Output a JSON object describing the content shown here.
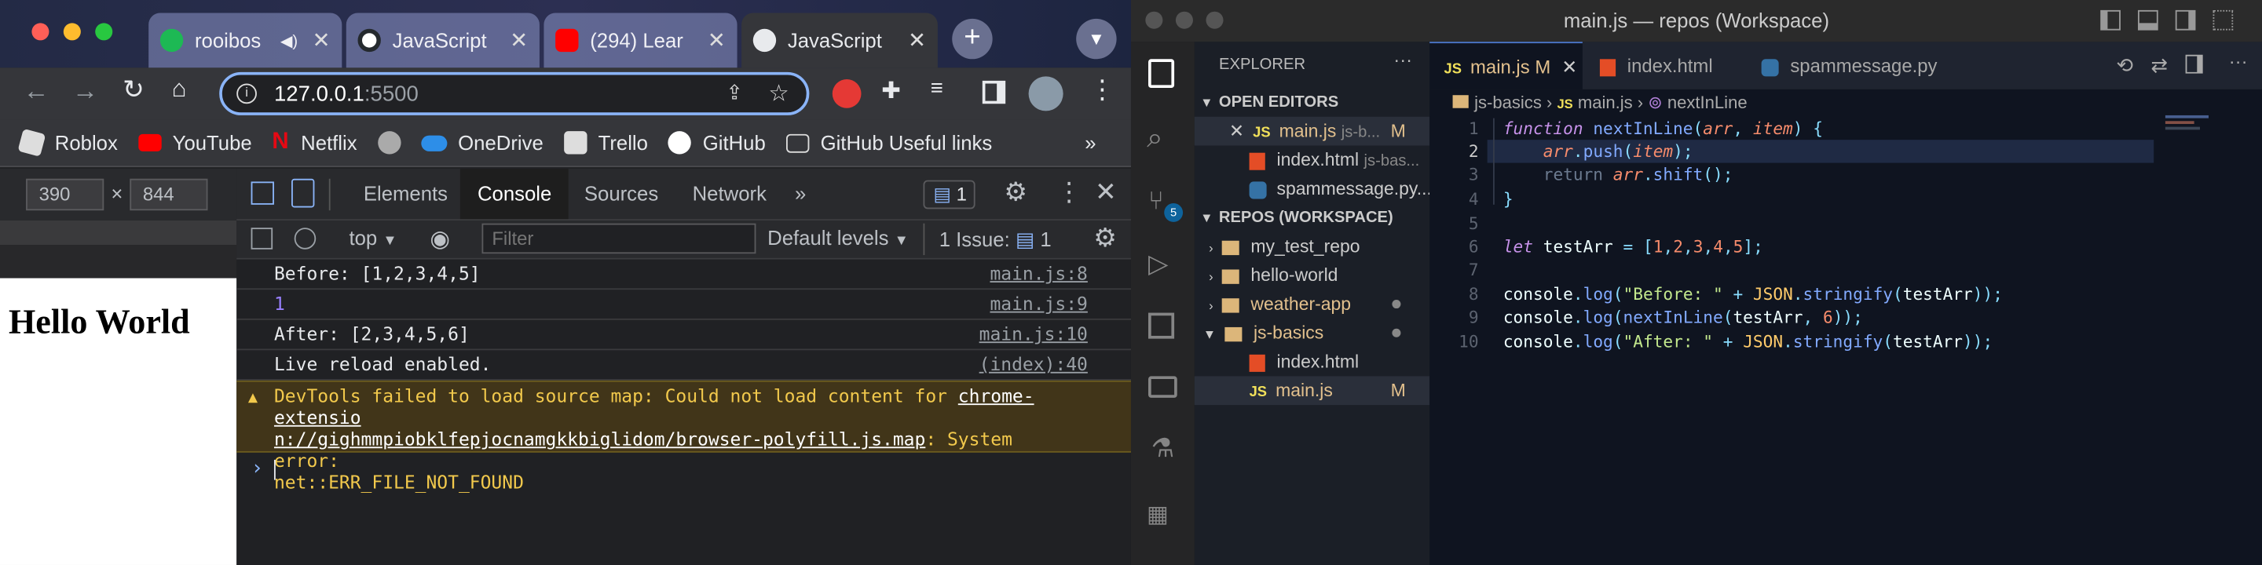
{
  "chrome": {
    "tabs": [
      {
        "label": "rooibos"
      },
      {
        "label": "JavaScript"
      },
      {
        "label": "(294) Lear"
      },
      {
        "label": "JavaScript"
      }
    ],
    "url_host": "127.0.0.1",
    "url_port": ":5500",
    "bookmarks": [
      "Roblox",
      "YouTube",
      "Netflix",
      "OneDrive",
      "Trello",
      "GitHub",
      "GitHub Useful links"
    ],
    "bookmarks_more": "»",
    "tab_close": "✕",
    "new_tab": "+",
    "more_tabs": "»"
  },
  "devtools": {
    "width": "390",
    "height": "844",
    "times": "×",
    "tabs": [
      "Elements",
      "Console",
      "Sources",
      "Network"
    ],
    "more": "»",
    "issues_badge": "1",
    "context": "top",
    "filter_placeholder": "Filter",
    "levels": "Default levels",
    "issues_text": "1 Issue:",
    "issues_count": "1",
    "page_heading": "Hello World",
    "console_rows": [
      {
        "text": "Before: [1,2,3,4,5]",
        "src": "main.js:8"
      },
      {
        "text": "1",
        "src": "main.js:9"
      },
      {
        "text": "After: [2,3,4,5,6]",
        "src": "main.js:10"
      },
      {
        "text": "Live reload enabled.",
        "src": "(index):40"
      }
    ],
    "warning_prefix": "DevTools failed to load source map: Could not load content for ",
    "warning_link_1": "chrome-extensio",
    "warning_link_2": "n://gighmmpiobklfepjocnamgkkbiglidom/browser-polyfill.js.map",
    "warning_suffix": ": System error:",
    "warning_error": "net::ERR_FILE_NOT_FOUND",
    "prompt": "›"
  },
  "vscode": {
    "title": "main.js — repos (Workspace)",
    "explorer": "EXPLORER",
    "open_editors": "OPEN EDITORS",
    "open_files": [
      {
        "name": "main.js",
        "path": "js-b...",
        "status": "M"
      },
      {
        "name": "index.html",
        "path": "js-bas..."
      },
      {
        "name": "spammessage.py..."
      }
    ],
    "workspace": "REPOS (WORKSPACE)",
    "folders": [
      {
        "name": "my_test_repo"
      },
      {
        "name": "hello-world"
      },
      {
        "name": "weather-app"
      },
      {
        "name": "js-basics"
      }
    ],
    "js_basics_files": [
      {
        "name": "index.html"
      },
      {
        "name": "main.js",
        "status": "M"
      }
    ],
    "scm_badge": "5",
    "editor_tabs": [
      {
        "name": "main.js",
        "status": "M"
      },
      {
        "name": "index.html"
      },
      {
        "name": "spammessage.py"
      }
    ],
    "breadcrumb": [
      "js-basics",
      "main.js",
      "nextInLine"
    ],
    "line_numbers": [
      "1",
      "2",
      "3",
      "4",
      "5",
      "6",
      "7",
      "8",
      "9",
      "10"
    ]
  },
  "colors": {
    "accent": "#8ab4f8",
    "warning_bg": "#413519",
    "vs_modified": "#e2c08d",
    "vs_keyword": "#c792ea",
    "vs_function": "#82aaff",
    "vs_string": "#c3e88d",
    "vs_number": "#f78c6c"
  }
}
